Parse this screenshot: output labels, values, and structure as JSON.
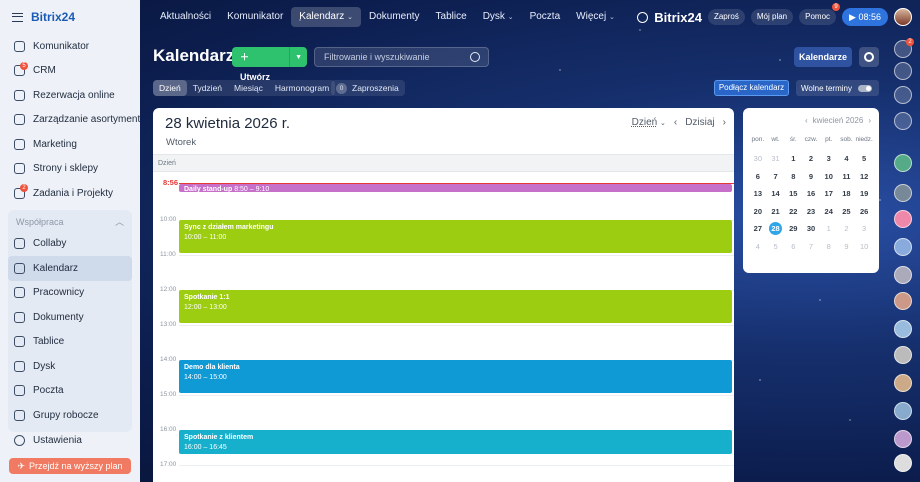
{
  "app": {
    "name": "Bitrix24"
  },
  "sidebar": {
    "items": [
      {
        "label": "Komunikator",
        "icon": "chat-icon"
      },
      {
        "label": "CRM",
        "icon": "crm-icon",
        "badge": "5"
      },
      {
        "label": "Rezerwacja online",
        "icon": "booking-icon"
      },
      {
        "label": "Zarządzanie asortymentem",
        "icon": "inventory-icon"
      },
      {
        "label": "Marketing",
        "icon": "marketing-icon"
      },
      {
        "label": "Strony i sklepy",
        "icon": "sites-icon"
      },
      {
        "label": "Zadania i Projekty",
        "icon": "tasks-icon",
        "badge": "2"
      }
    ],
    "group_label": "Współpraca",
    "group_items": [
      {
        "label": "Collaby",
        "icon": "collab-icon"
      },
      {
        "label": "Kalendarz",
        "icon": "calendar-icon"
      },
      {
        "label": "Pracownicy",
        "icon": "employees-icon"
      },
      {
        "label": "Dokumenty",
        "icon": "documents-icon"
      },
      {
        "label": "Tablice",
        "icon": "boards-icon"
      },
      {
        "label": "Dysk",
        "icon": "drive-icon"
      },
      {
        "label": "Poczta",
        "icon": "mail-icon"
      },
      {
        "label": "Grupy robocze",
        "icon": "groups-icon"
      }
    ],
    "settings": "Ustawienia",
    "upgrade": "Przejdź na wyższy plan"
  },
  "topbar": {
    "items": [
      "Aktualności",
      "Komunikator",
      "Kalendarz",
      "Dokumenty",
      "Tablice",
      "Dysk",
      "Poczta",
      "Więcej"
    ],
    "brand": "Bitrix24",
    "invite": "Zaproś",
    "my_plan": "Mój plan",
    "help": "Pomoc",
    "help_badge": "9",
    "clock": "08:56"
  },
  "page": {
    "title": "Kalendarz",
    "create": "Utwórz",
    "filter_placeholder": "Filtrowanie i wyszukiwanie",
    "calendars_btn": "Kalendarze",
    "views": [
      "Dzień",
      "Tydzień",
      "Miesiąc",
      "Harmonogram"
    ],
    "invites_count": "0",
    "invites_label": "Zaproszenia",
    "connect": "Podłącz kalendarz",
    "free_slots": "Wolne terminy"
  },
  "calendar": {
    "date": "28 kwietnia 2026 r.",
    "weekday": "Wtorek",
    "view_selector": "Dzień",
    "today": "Dzisiaj",
    "column_label": "Dzień",
    "now": "8:56",
    "hours": [
      "10:00",
      "11:00",
      "12:00",
      "13:00",
      "14:00",
      "15:00",
      "16:00",
      "17:00"
    ],
    "events": [
      {
        "title": "Daily stand-up",
        "time": "8:50 – 9:10",
        "color": "#c770c9"
      },
      {
        "title": "Sync z działem marketingu",
        "time": "10:00 – 11:00",
        "color": "#9ccd10"
      },
      {
        "title": "Spotkanie 1:1",
        "time": "12:00 – 13:00",
        "color": "#9ccd10"
      },
      {
        "title": "Demo dla klienta",
        "time": "14:00 – 15:00",
        "color": "#0f9ad6"
      },
      {
        "title": "Spotkanie z klientem",
        "time": "16:00 – 16:45",
        "color": "#17b0cc"
      }
    ]
  },
  "mini_calendar": {
    "month": "kwiecień 2026",
    "weekdays": [
      "pon.",
      "wt.",
      "śr.",
      "czw.",
      "pt.",
      "sob.",
      "niedz."
    ],
    "days": [
      "30",
      "31",
      "1",
      "2",
      "3",
      "4",
      "5",
      "6",
      "7",
      "8",
      "9",
      "10",
      "11",
      "12",
      "13",
      "14",
      "15",
      "16",
      "17",
      "18",
      "19",
      "20",
      "21",
      "22",
      "23",
      "24",
      "25",
      "26",
      "27",
      "28",
      "29",
      "30",
      "1",
      "2",
      "3",
      "4",
      "5",
      "6",
      "7",
      "8",
      "9",
      "10"
    ]
  },
  "right_bar": {
    "notif_badge": "2"
  }
}
